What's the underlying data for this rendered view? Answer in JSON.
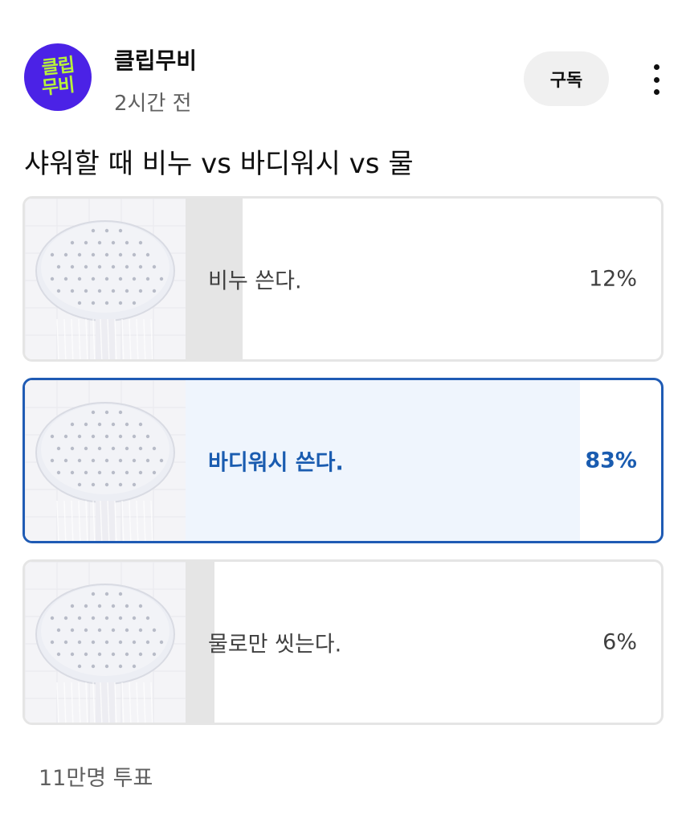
{
  "channel": {
    "name": "클립무비",
    "avatar_line1": "클립",
    "avatar_line2": "무비",
    "avatar_bg": "#4b22e6",
    "avatar_fg": "#b8f23a"
  },
  "post": {
    "time": "2시간 전",
    "subscribe_label": "구독",
    "question": "샤워할 때 비누 vs 바디워시 vs 물",
    "total_votes": "11만명 투표"
  },
  "options": [
    {
      "label": "비누 쓴다.",
      "percent_text": "12%",
      "fraction": 0.12,
      "selected": false,
      "image": "shower-head"
    },
    {
      "label": "바디워시 쓴다.",
      "percent_text": "83%",
      "fraction": 0.83,
      "selected": true,
      "image": "shower-head"
    },
    {
      "label": "물로만 씻는다.",
      "percent_text": "6%",
      "fraction": 0.06,
      "selected": false,
      "image": "shower-head"
    }
  ],
  "colors": {
    "selected_border": "#1f5bb4",
    "selected_text": "#1a5cb0",
    "selected_fill": "#eff5fd",
    "bar_fill": "#e5e5e5"
  }
}
